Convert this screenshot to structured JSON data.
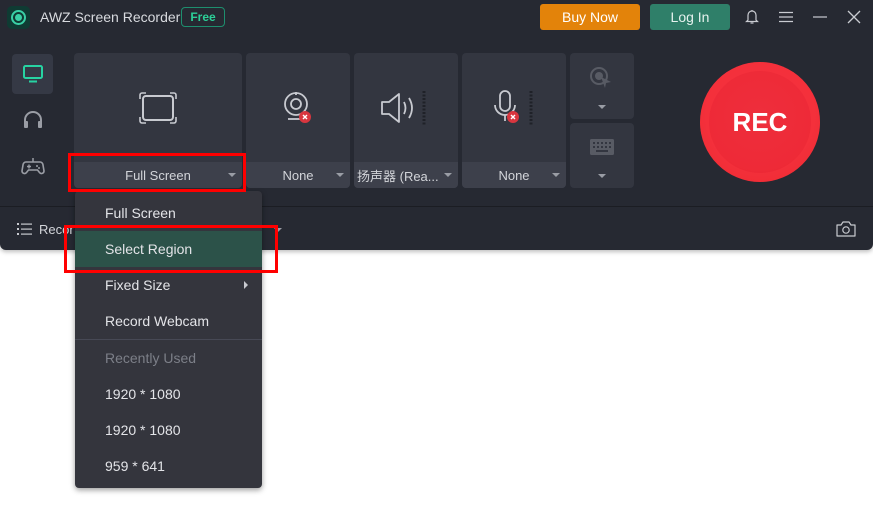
{
  "titlebar": {
    "app_title": "AWZ Screen Recorder",
    "badge": "Free",
    "buy_label": "Buy Now",
    "login_label": "Log In",
    "icons": [
      "bell-icon",
      "menu-icon",
      "minimize-icon",
      "close-icon"
    ]
  },
  "sidebar": {
    "tabs": [
      {
        "name": "screen",
        "icon": "monitor-icon",
        "active": true
      },
      {
        "name": "audio",
        "icon": "headphones-icon",
        "active": false
      },
      {
        "name": "game",
        "icon": "gamepad-icon",
        "active": false
      }
    ]
  },
  "controls": {
    "screen_mode": "Full Screen",
    "webcam": "None",
    "speaker": "扬声器 (Rea...",
    "microphone": "None",
    "rec_label": "REC"
  },
  "bottom_bar": {
    "list_label": "Recor"
  },
  "dropdown": {
    "items": [
      {
        "label": "Full Screen"
      },
      {
        "label": "Select Region",
        "selected": true
      },
      {
        "label": "Fixed Size",
        "submenu": true
      },
      {
        "label": "Record Webcam"
      }
    ],
    "recent_header": "Recently Used",
    "recent": [
      "1920 * 1080",
      "1920 * 1080",
      "959 * 641"
    ]
  },
  "colors": {
    "accent_green": "#2ccf98",
    "buy": "#e3830a",
    "login": "#2f7f69",
    "rec": "#ee2a37",
    "highlight": "#ff0000"
  }
}
